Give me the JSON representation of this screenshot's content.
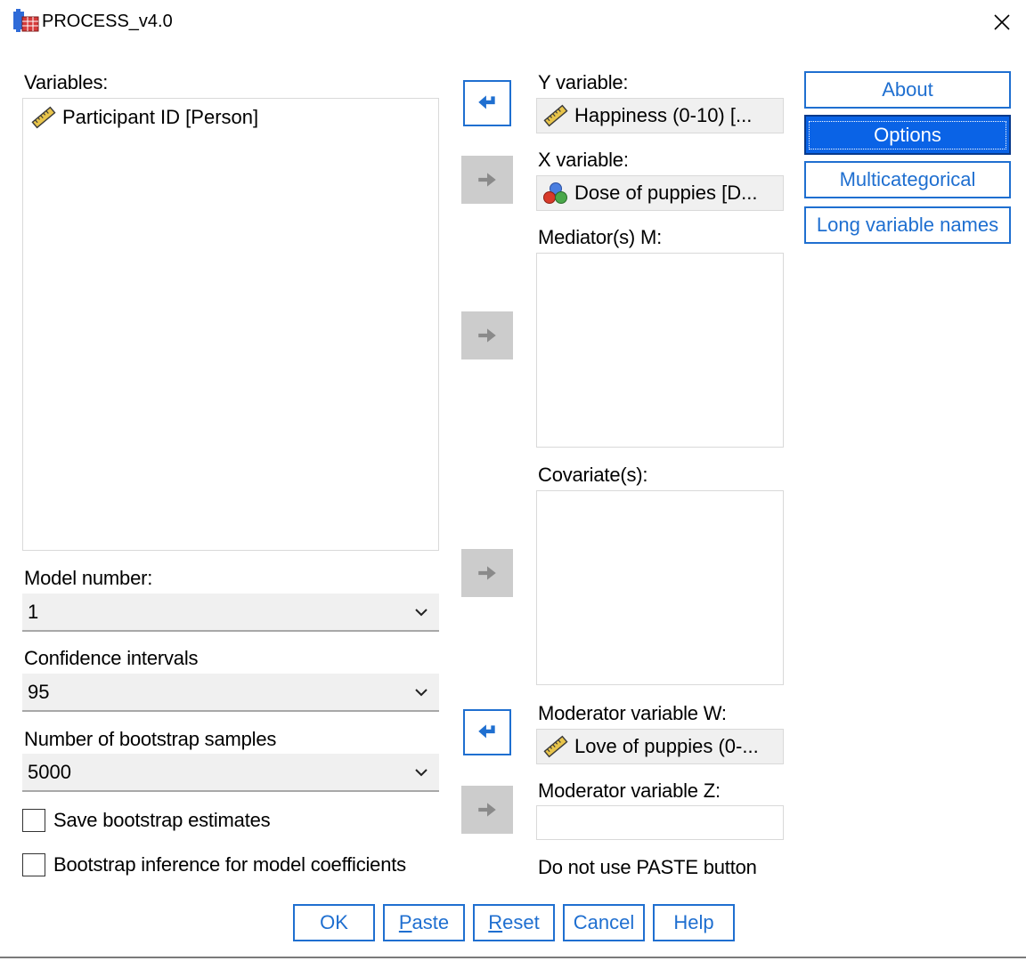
{
  "window": {
    "title": "PROCESS_v4.0"
  },
  "variables": {
    "label": "Variables:",
    "items": [
      {
        "text": "Participant ID [Person]",
        "icon": "ruler-scale-icon"
      }
    ]
  },
  "y_variable": {
    "label": "Y variable:",
    "value": "Happiness (0-10) [...",
    "icon": "ruler-scale-icon"
  },
  "x_variable": {
    "label": "X variable:",
    "value": "Dose of puppies [D...",
    "icon": "nominal-circles-icon"
  },
  "mediators": {
    "label": "Mediator(s) M:"
  },
  "covariates": {
    "label": "Covariate(s):"
  },
  "moderator_w": {
    "label": "Moderator variable W:",
    "value": "Love of puppies (0-...",
    "icon": "ruler-scale-icon"
  },
  "moderator_z": {
    "label": "Moderator variable Z:"
  },
  "paste_note": "Do not use PASTE button",
  "model_number": {
    "label": "Model number:",
    "value": "1"
  },
  "confidence_intervals": {
    "label": "Confidence intervals",
    "value": "95"
  },
  "bootstrap_samples": {
    "label": "Number of bootstrap samples",
    "value": "5000"
  },
  "checkboxes": {
    "save_bootstrap": {
      "label": "Save bootstrap estimates",
      "checked": false
    },
    "bootstrap_inference": {
      "label": "Bootstrap inference for model coefficients",
      "checked": false
    }
  },
  "side_buttons": {
    "about": "About",
    "options": "Options",
    "multicategorical": "Multicategorical",
    "long_names": "Long variable names"
  },
  "bottom_buttons": {
    "ok": "OK",
    "paste_mnemonic": "P",
    "paste_rest": "aste",
    "reset_mnemonic": "R",
    "reset_rest": "eset",
    "cancel": "Cancel",
    "help": "Help"
  },
  "colors": {
    "accent": "#1f6fd0",
    "selected_button": "#0a63e6",
    "disabled_arrow": "#cccccc",
    "slot_background": "#f0f0f0"
  }
}
